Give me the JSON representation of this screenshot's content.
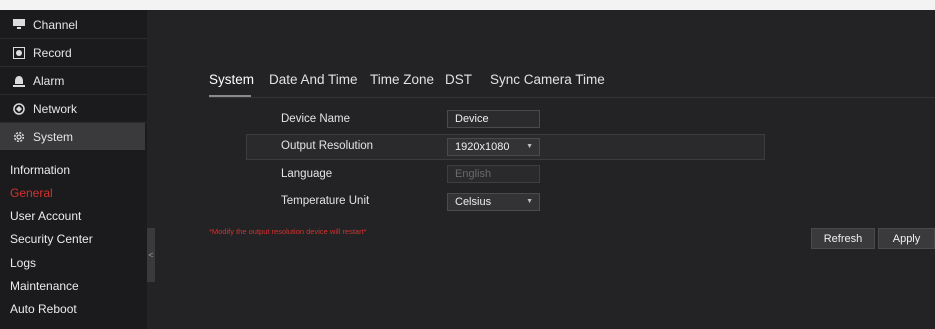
{
  "sidebar": {
    "menu": [
      {
        "label": "Channel",
        "icon": "monitor-icon"
      },
      {
        "label": "Record",
        "icon": "record-icon"
      },
      {
        "label": "Alarm",
        "icon": "alarm-icon"
      },
      {
        "label": "Network",
        "icon": "network-icon"
      },
      {
        "label": "System",
        "icon": "gear-icon"
      }
    ],
    "submenu": [
      {
        "label": "Information"
      },
      {
        "label": "General"
      },
      {
        "label": "User Account"
      },
      {
        "label": "Security Center"
      },
      {
        "label": "Logs"
      },
      {
        "label": "Maintenance"
      },
      {
        "label": "Auto Reboot"
      }
    ],
    "collapse_glyph": "<"
  },
  "tabs": [
    {
      "label": "System",
      "active": true
    },
    {
      "label": "Date And Time"
    },
    {
      "label": "Time Zone"
    },
    {
      "label": "DST"
    },
    {
      "label": "Sync Camera Time"
    }
  ],
  "form": {
    "device_name": {
      "label": "Device Name",
      "value": "Device"
    },
    "output_resolution": {
      "label": "Output Resolution",
      "value": "1920x1080"
    },
    "language": {
      "label": "Language",
      "value": "English"
    },
    "temperature_unit": {
      "label": "Temperature Unit",
      "value": "Celsius"
    }
  },
  "warning": "*Modify the output resolution device will restart*",
  "buttons": {
    "refresh": "Refresh",
    "apply": "Apply"
  },
  "colors": {
    "accent_red": "#d3322c",
    "background": "#232326",
    "sidebar": "#1b1b1d"
  }
}
